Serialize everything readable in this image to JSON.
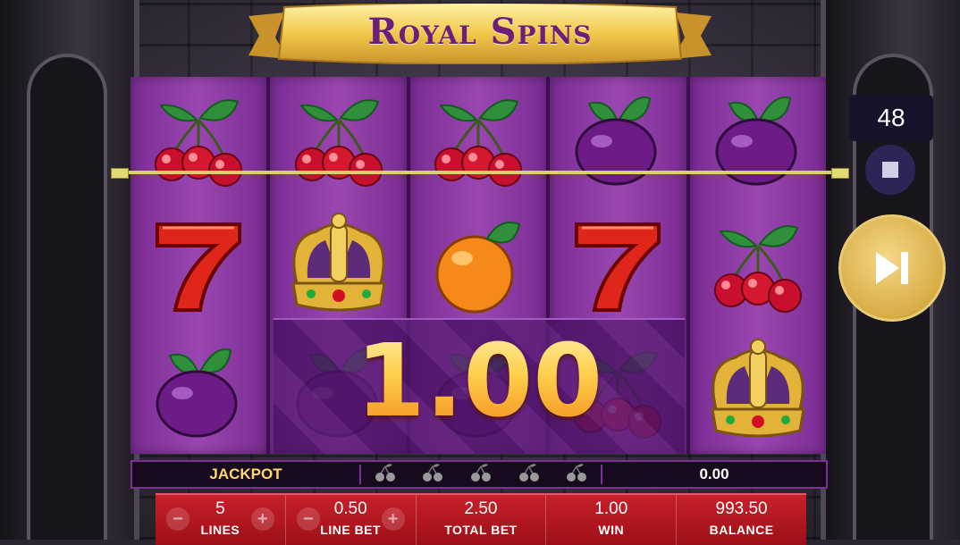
{
  "game": {
    "title": "Royal Spins"
  },
  "reels": [
    [
      "cherry-icon",
      "seven-icon",
      "plum-icon"
    ],
    [
      "cherry-icon",
      "crown-icon",
      "plum-icon"
    ],
    [
      "cherry-icon",
      "orange-icon",
      "plum-icon"
    ],
    [
      "plum-icon",
      "seven-icon",
      "cherry-icon"
    ],
    [
      "plum-icon",
      "cherry-icon",
      "crown-icon"
    ]
  ],
  "win": {
    "amount": "1.00"
  },
  "controls": {
    "autoplay_counter": "48"
  },
  "jackpot": {
    "label": "JACKPOT",
    "symbol_count": 5,
    "value": "0.00"
  },
  "bottom_bar": {
    "lines": {
      "value": "5",
      "label": "LINES"
    },
    "line_bet": {
      "value": "0.50",
      "label": "LINE BET"
    },
    "total_bet": {
      "value": "2.50",
      "label": "TOTAL BET"
    },
    "win": {
      "value": "1.00",
      "label": "WIN"
    },
    "balance": {
      "value": "993.50",
      "label": "BALANCE"
    },
    "minus_symbol": "−",
    "plus_symbol": "+"
  },
  "colors": {
    "reel_purple": "#9a46b1",
    "gold": "#e3b54a",
    "bar_red": "#c8202a"
  }
}
